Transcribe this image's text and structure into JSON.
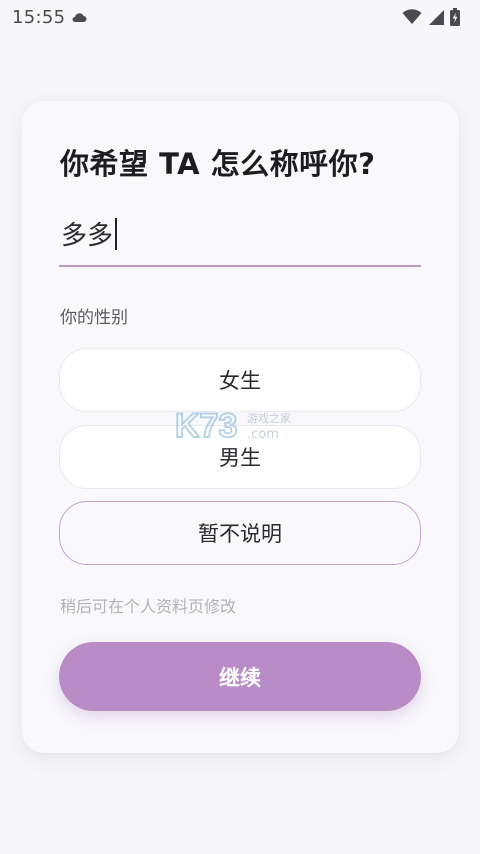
{
  "status_bar": {
    "time": "15:55"
  },
  "form": {
    "title": "你希望 TA 怎么称呼你?",
    "name_value": "多多",
    "gender_label": "你的性别",
    "options": [
      {
        "label": "女生",
        "selected": false
      },
      {
        "label": "男生",
        "selected": false
      },
      {
        "label": "暂不说明",
        "selected": true
      }
    ],
    "hint": "稍后可在个人资料页修改",
    "continue_label": "继续"
  },
  "watermark": {
    "logo_text": "K73",
    "sub_text": "游戏之家",
    "domain_text": ".com"
  },
  "colors": {
    "accent": "#b98cc8",
    "underline": "#b99ac7",
    "selected_border": "#c4a3cf",
    "background": "#f7f6fa"
  }
}
